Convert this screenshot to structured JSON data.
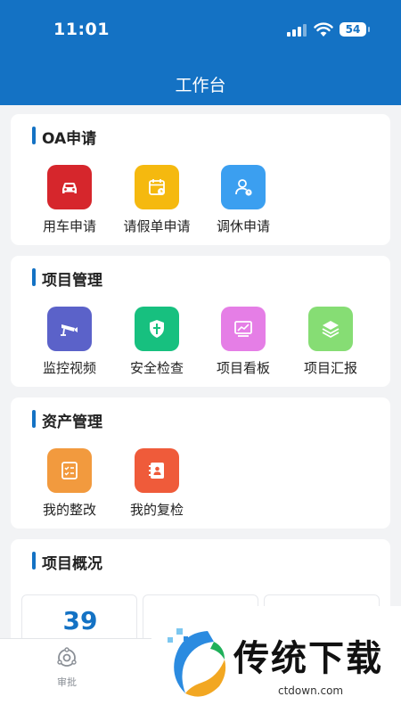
{
  "status_bar": {
    "time": "11:01",
    "battery": "54"
  },
  "header": {
    "title": "工作台"
  },
  "sections": {
    "oa": {
      "title": "OA申请",
      "items": [
        {
          "label": "用车申请",
          "icon": "car-icon",
          "color": "#d6262c"
        },
        {
          "label": "请假单申请",
          "icon": "calendar-icon",
          "color": "#f5b90f"
        },
        {
          "label": "调休申请",
          "icon": "user-clock-icon",
          "color": "#3b9ff0"
        }
      ]
    },
    "project": {
      "title": "项目管理",
      "items": [
        {
          "label": "监控视频",
          "icon": "camera-icon",
          "color": "#5b62c9"
        },
        {
          "label": "安全检查",
          "icon": "shield-icon",
          "color": "#17c07f"
        },
        {
          "label": "项目看板",
          "icon": "chart-board-icon",
          "color": "#e57ee6"
        },
        {
          "label": "项目汇报",
          "icon": "layers-icon",
          "color": "#86dd74"
        }
      ]
    },
    "asset": {
      "title": "资产管理",
      "items": [
        {
          "label": "我的整改",
          "icon": "checklist-icon",
          "color": "#f29a3e"
        },
        {
          "label": "我的复检",
          "icon": "contact-book-icon",
          "color": "#ef5b3a"
        }
      ]
    },
    "overview": {
      "title": "项目概况",
      "stats": [
        {
          "value": "39"
        }
      ]
    }
  },
  "tabbar": {
    "approve_label": "审批"
  },
  "watermark": {
    "text": "传统下载",
    "url": "ctdown.com"
  }
}
